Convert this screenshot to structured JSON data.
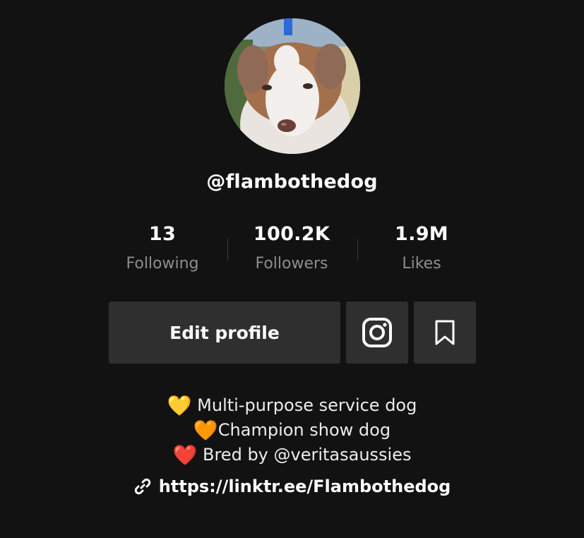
{
  "profile": {
    "username": "@flambothedog",
    "avatar_icon": "dog-avatar"
  },
  "stats": [
    {
      "value": "13",
      "label": "Following"
    },
    {
      "value": "100.2K",
      "label": "Followers"
    },
    {
      "value": "1.9M",
      "label": "Likes"
    }
  ],
  "actions": {
    "edit_profile_label": "Edit profile",
    "instagram_icon": "instagram-icon",
    "bookmark_icon": "bookmark-icon"
  },
  "bio": {
    "lines": [
      {
        "emoji": "💛",
        "text": " Multi-purpose service dog"
      },
      {
        "emoji": "🧡",
        "text": "Champion show dog"
      },
      {
        "emoji": "❤️",
        "text": " Bred by @veritasaussies"
      }
    ]
  },
  "link": {
    "icon": "link-icon",
    "url": "https://linktr.ee/Flambothedog"
  },
  "colors": {
    "background": "#121212",
    "button": "#2f2f2f",
    "muted_text": "#8d8d8d",
    "heart_yellow": "#f6c73a",
    "heart_orange": "#f28a1e",
    "heart_red": "#e3262f"
  }
}
